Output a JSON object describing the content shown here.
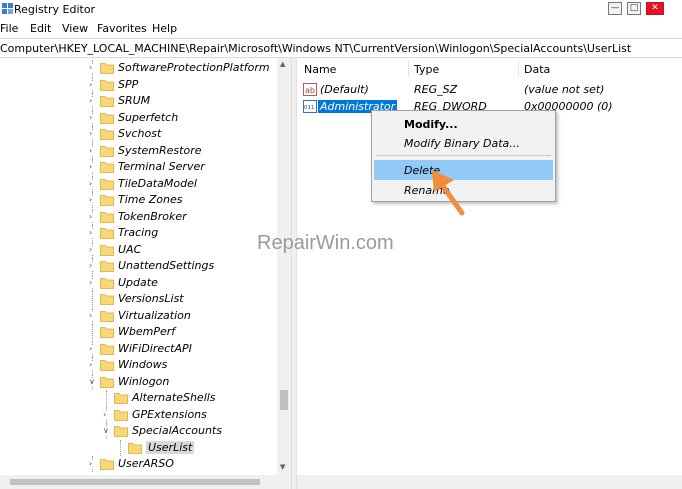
{
  "window": {
    "title": "Registry Editor",
    "controls": {
      "minimize": "—",
      "maximize": "□",
      "close": "✕"
    }
  },
  "menu": [
    "File",
    "Edit",
    "View",
    "Favorites",
    "Help"
  ],
  "address": "Computer\\HKEY_LOCAL_MACHINE\\Repair\\Microsoft\\Windows NT\\CurrentVersion\\Winlogon\\SpecialAccounts\\UserList",
  "tree": {
    "items": [
      {
        "label": "SoftwareProtectionPlatform",
        "expander": "collapsed"
      },
      {
        "label": "SPP",
        "expander": "collapsed"
      },
      {
        "label": "SRUM",
        "expander": "collapsed"
      },
      {
        "label": "Superfetch",
        "expander": "collapsed"
      },
      {
        "label": "Svchost",
        "expander": "collapsed"
      },
      {
        "label": "SystemRestore",
        "expander": "collapsed"
      },
      {
        "label": "Terminal Server",
        "expander": "collapsed"
      },
      {
        "label": "TileDataModel",
        "expander": "collapsed"
      },
      {
        "label": "Time Zones",
        "expander": "collapsed"
      },
      {
        "label": "TokenBroker",
        "expander": "collapsed"
      },
      {
        "label": "Tracing",
        "expander": "collapsed"
      },
      {
        "label": "UAC",
        "expander": "collapsed"
      },
      {
        "label": "UnattendSettings",
        "expander": "collapsed"
      },
      {
        "label": "Update",
        "expander": "collapsed"
      },
      {
        "label": "VersionsList",
        "expander": "none"
      },
      {
        "label": "Virtualization",
        "expander": "collapsed"
      },
      {
        "label": "WbemPerf",
        "expander": "none"
      },
      {
        "label": "WiFiDirectAPI",
        "expander": "collapsed"
      },
      {
        "label": "Windows",
        "expander": "collapsed"
      },
      {
        "label": "Winlogon",
        "expander": "expanded"
      },
      {
        "label": "AlternateShells",
        "expander": "none"
      },
      {
        "label": "GPExtensions",
        "expander": "collapsed"
      },
      {
        "label": "SpecialAccounts",
        "expander": "expanded"
      },
      {
        "label": "UserList",
        "expander": "none",
        "selected": true
      },
      {
        "label": "UserARSO",
        "expander": "collapsed"
      }
    ]
  },
  "list": {
    "columns": [
      "Name",
      "Type",
      "Data"
    ],
    "rows": [
      {
        "icon": "string-value-icon",
        "icon_text": "ab",
        "name": "(Default)",
        "type": "REG_SZ",
        "data": "(value not set)"
      },
      {
        "icon": "binary-value-icon",
        "icon_text": "011",
        "name": "Administrator",
        "type": "REG_DWORD",
        "data": "0x00000000 (0)",
        "selected": true
      }
    ]
  },
  "context_menu": {
    "items": [
      "Modify...",
      "Modify Binary Data...",
      "Delete",
      "Rename"
    ],
    "highlighted": "Delete"
  },
  "watermark": "RepairWin.com",
  "colors": {
    "selection": "#0078d7",
    "menu_highlight": "#91c9f7",
    "folder": "#f8d775",
    "arrow": "#f28c38"
  }
}
